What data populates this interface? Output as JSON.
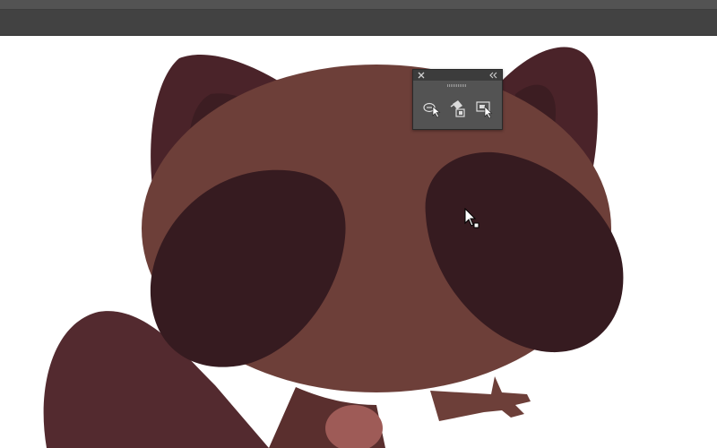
{
  "window": {
    "menu_bar": "",
    "control_bar": ""
  },
  "palette": {
    "canvas": "#ffffff",
    "chrome_dark": "#424242",
    "chrome_light": "#535353",
    "face": "#6d3f39",
    "ears": "#4a2329",
    "eye_patches": "#361b20",
    "tail": "#532a2f",
    "hand": "#6d3f39",
    "scarf": "#5a2f2e",
    "nose": "#9e5b57"
  },
  "artwork": {
    "subject": "raccoon-character"
  },
  "floating_panel": {
    "close_icon": "close-icon",
    "collapse_icon": "double-chevron-left-icon",
    "tools": [
      {
        "name": "shape-builder-tool",
        "icon": "shape-builder-icon"
      },
      {
        "name": "live-paint-bucket-tool",
        "icon": "live-paint-bucket-icon"
      },
      {
        "name": "live-paint-selection-tool",
        "icon": "live-paint-selection-icon"
      }
    ]
  },
  "cursor": {
    "icon": "arrow-pointer-with-square-icon"
  }
}
